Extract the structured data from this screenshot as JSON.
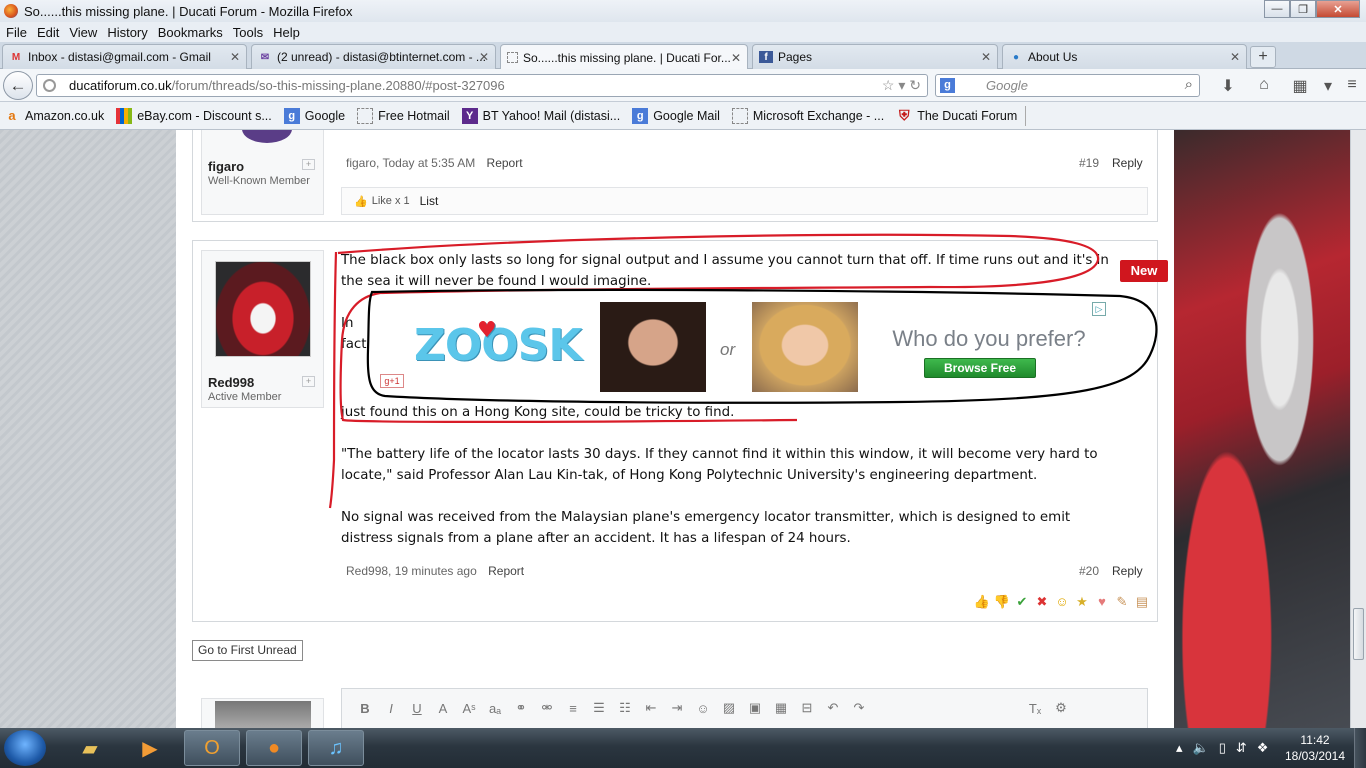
{
  "window": {
    "title": "So......this missing plane. | Ducati Forum - Mozilla Firefox"
  },
  "menu": [
    "File",
    "Edit",
    "View",
    "History",
    "Bookmarks",
    "Tools",
    "Help"
  ],
  "tabs": [
    {
      "label": "Inbox - distasi@gmail.com - Gmail",
      "icon": "gmail-icon"
    },
    {
      "label": "(2 unread) - distasi@btinternet.com - ...",
      "icon": "mail-icon"
    },
    {
      "label": "So......this missing plane. | Ducati For...",
      "icon": "page-icon",
      "active": true
    },
    {
      "label": "Pages",
      "icon": "facebook-icon"
    },
    {
      "label": "About Us",
      "icon": "globe-icon"
    }
  ],
  "nav": {
    "url_domain": "ducatiforum.co.uk",
    "url_path": "/forum/threads/so-this-missing-plane.20880/#post-327096",
    "search_placeholder": "Google"
  },
  "bookmarks": [
    {
      "label": "Amazon.co.uk",
      "icon": "amazon-icon"
    },
    {
      "label": "eBay.com - Discount s...",
      "icon": "ebay-icon"
    },
    {
      "label": "Google",
      "icon": "google-icon"
    },
    {
      "label": "Free Hotmail",
      "icon": "blank-icon"
    },
    {
      "label": "BT Yahoo! Mail (distasi...",
      "icon": "yahoo-icon"
    },
    {
      "label": "Google Mail",
      "icon": "google-icon"
    },
    {
      "label": "Microsoft Exchange - ...",
      "icon": "blank-icon"
    },
    {
      "label": "The Ducati Forum",
      "icon": "ducati-icon"
    }
  ],
  "post19": {
    "username": "figaro",
    "user_title": "Well-Known Member",
    "meta": "figaro, Today at 5:35 AM",
    "report": "Report",
    "number": "#19",
    "reply": "Reply",
    "likes": "Like x 1",
    "list": "List"
  },
  "post20": {
    "username": "Red998",
    "user_title": "Active Member",
    "badge": "New",
    "para1": "The black box only lasts so long for signal output and I assume you cannot turn that off. If time runs out and it's in the sea it will never be found I would imagine.",
    "para2_a": "In",
    "para2_b": "fact",
    "para3": "just found this on a Hong Kong site, could be tricky to find.",
    "para4": "\"The battery life of the locator lasts 30 days. If they cannot find it within this window, it will become very hard to locate,\" said Professor Alan Lau Kin-tak, of Hong Kong Polytechnic University's engineering department.",
    "para5": "No signal was received from the Malaysian plane's emergency locator transmitter, which is designed to emit distress signals from a plane after an accident. It has a lifespan of 24 hours.",
    "meta": "Red998, 19 minutes ago",
    "report": "Report",
    "number": "#20",
    "reply": "Reply"
  },
  "ad": {
    "brand": "ZOOSK",
    "gplus": "g+1",
    "or": "or",
    "question": "Who do you prefer?",
    "button": "Browse Free"
  },
  "go_first_unread": "Go to First Unread",
  "taskbar": {
    "time": "11:42",
    "date": "18/03/2014"
  },
  "colors": {
    "accent_red": "#d0161e",
    "annotation_red": "#d81c28",
    "ad_green": "#2aa13a",
    "zoosk_blue": "#5bc6ea"
  }
}
